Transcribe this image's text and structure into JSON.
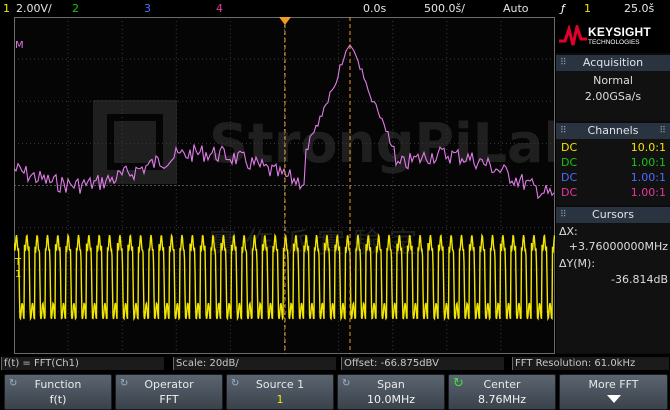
{
  "top_bar": {
    "ch1_label": "1",
    "ch1_scale": "2.00V/",
    "ch2_label": "2",
    "ch3_label": "3",
    "ch4_label": "4",
    "time_pos": "0.0s",
    "time_scale": "500.0š/",
    "trigger_mode": "Auto",
    "trigger_icon": "ƒ",
    "trigger_source": "1",
    "trigger_level": "25.0š"
  },
  "colors": {
    "ch1": "#f2e600",
    "ch2": "#19c419",
    "ch3": "#4d6cff",
    "ch4": "#e8389a",
    "math": "#e07be8",
    "cursor": "#f09a2a"
  },
  "logo": {
    "brand": "KEYSIGHT",
    "sub": "TECHNOLOGIES"
  },
  "acquisition": {
    "title": "Acquisition",
    "mode": "Normal",
    "rate": "2.00GSa/s"
  },
  "channels": {
    "title": "Channels",
    "rows": [
      {
        "coupling": "DC",
        "value": "10.0:1",
        "color": "#f2e600"
      },
      {
        "coupling": "DC",
        "value": "1.00:1",
        "color": "#19c419"
      },
      {
        "coupling": "DC",
        "value": "1.00:1",
        "color": "#4d6cff"
      },
      {
        "coupling": "DC",
        "value": "1.00:1",
        "color": "#e8389a"
      }
    ]
  },
  "cursors": {
    "title": "Cursors",
    "dx_label": "ΔX:",
    "dx_value": "+3.76000000MHz",
    "dy_label": "ΔY(M):",
    "dy_value": "-36.814dB"
  },
  "markers": {
    "math_marker": "M",
    "ch1_marker": "1",
    "trigger_marker": "T"
  },
  "info_bar": {
    "function": "f(t) = FFT(Ch1)",
    "scale": "Scale: 20dB/",
    "offset": "Offset: -66.875dBV",
    "resolution": "FFT Resolution: 61.0kHz"
  },
  "watermark": {
    "text": "StrongPiLab",
    "cjk": "實作派實驗室"
  },
  "softkeys": [
    {
      "top": "Function",
      "bottom": "f(t)"
    },
    {
      "top": "Operator",
      "bottom": "FFT"
    },
    {
      "top": "Source 1",
      "bottom": "1"
    },
    {
      "top": "Span",
      "bottom": "10.0MHz"
    },
    {
      "top": "Center",
      "bottom": "8.76MHz"
    },
    {
      "top": "More FFT",
      "bottom": ""
    }
  ]
}
